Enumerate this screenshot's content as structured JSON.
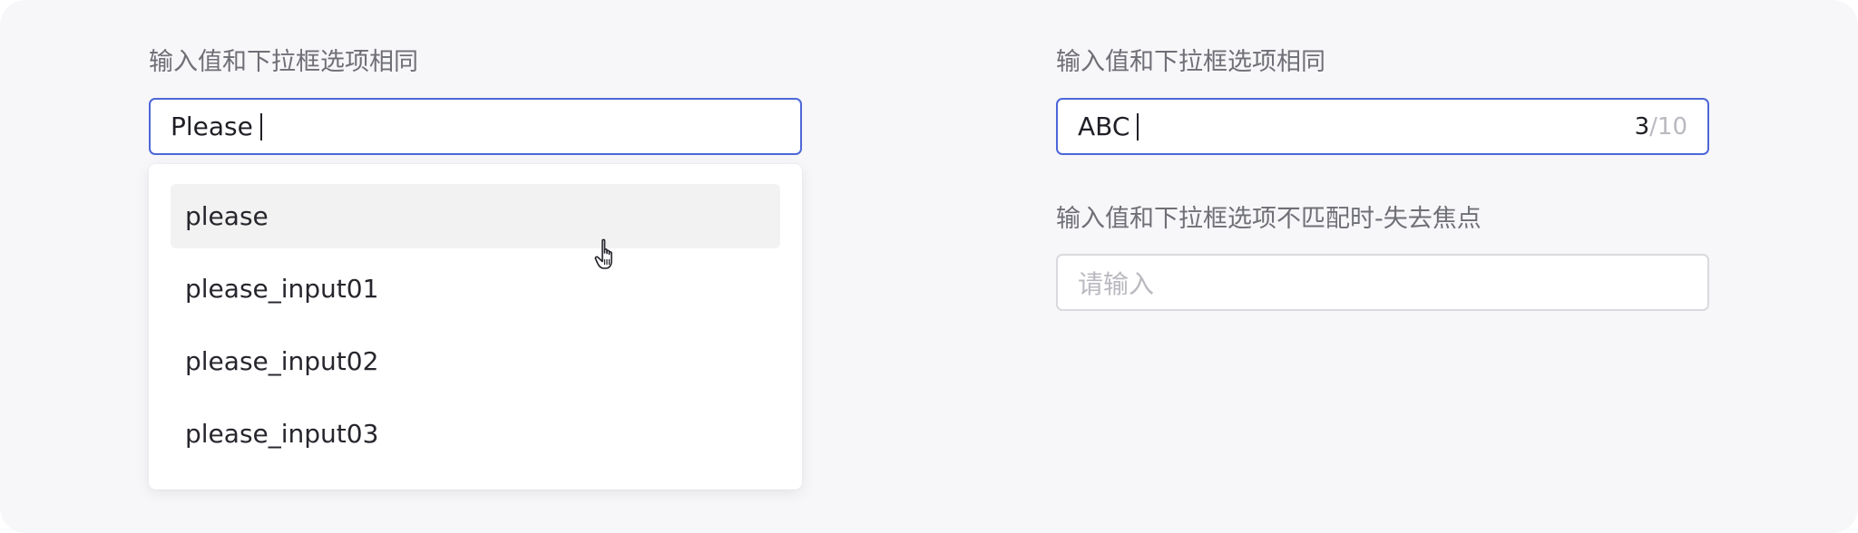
{
  "left": {
    "label": "输入值和下拉框选项相同",
    "input": {
      "value": "Please",
      "focused": true
    },
    "dropdown": {
      "options": [
        {
          "label": "please",
          "hovered": true
        },
        {
          "label": "please_input01",
          "hovered": false
        },
        {
          "label": "please_input02",
          "hovered": false
        },
        {
          "label": "please_input03",
          "hovered": false
        }
      ]
    }
  },
  "right_top": {
    "label": "输入值和下拉框选项相同",
    "input": {
      "value": "ABC",
      "focused": true
    },
    "counter": {
      "count": "3",
      "separator": "/",
      "max": "10"
    }
  },
  "right_bottom": {
    "label": "输入值和下拉框选项不匹配时-失去焦点",
    "input": {
      "placeholder": "请输入",
      "focused": false
    }
  },
  "colors": {
    "focus_border": "#4d67d8",
    "idle_border": "#d9d9de",
    "panel_background": "#f7f7f9",
    "hover_background": "#f2f2f2"
  },
  "icons": {
    "pointer": "hand-pointer-icon"
  }
}
